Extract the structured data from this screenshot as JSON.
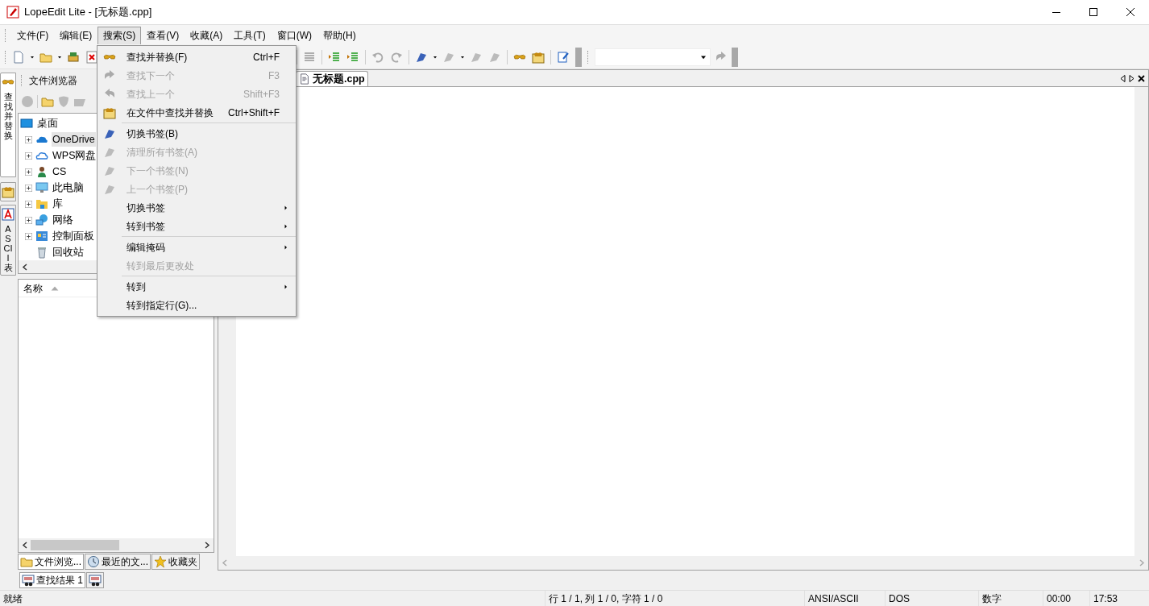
{
  "window": {
    "title": "LopeEdit Lite - [无标题.cpp]"
  },
  "menubar": [
    {
      "label": "文件(F)",
      "selected": false
    },
    {
      "label": "编辑(E)",
      "selected": false
    },
    {
      "label": "搜索(S)",
      "selected": true
    },
    {
      "label": "查看(V)",
      "selected": false
    },
    {
      "label": "收藏(A)",
      "selected": false
    },
    {
      "label": "工具(T)",
      "selected": false
    },
    {
      "label": "窗口(W)",
      "selected": false
    },
    {
      "label": "帮助(H)",
      "selected": false
    }
  ],
  "side_tabs": [
    {
      "kind": "text",
      "label": "查找并替换",
      "selected": true
    },
    {
      "kind": "icon",
      "selected": false
    },
    {
      "kind": "text",
      "label": "ASCII 表",
      "selected": false
    }
  ],
  "file_browser": {
    "title": "文件浏览器",
    "tree": [
      {
        "label": "桌面",
        "selected": false,
        "children": [
          {
            "label": "OneDrive",
            "expanded": false,
            "selected": true
          },
          {
            "label": "WPS网盘",
            "expanded": false,
            "selected": false
          },
          {
            "label": "CS",
            "expanded": false,
            "selected": false
          },
          {
            "label": "此电脑",
            "expanded": false,
            "selected": false
          },
          {
            "label": "库",
            "expanded": false,
            "selected": false
          },
          {
            "label": "网络",
            "expanded": false,
            "selected": false
          },
          {
            "label": "控制面板",
            "expanded": false,
            "selected": false
          },
          {
            "label": "回收站",
            "selected": false
          }
        ]
      }
    ],
    "columns": [
      {
        "label": "名称",
        "sorted": true
      }
    ],
    "tabs": [
      {
        "label": "文件浏览...",
        "selected": true
      },
      {
        "label": "最近的文...",
        "selected": false
      },
      {
        "label": "收藏夹",
        "selected": false
      }
    ]
  },
  "editor": {
    "tabs": [
      {
        "label": "无标题.cpp",
        "selected": true
      }
    ]
  },
  "menu": [
    {
      "kind": "item",
      "label": "查找并替换(F)",
      "shortcut": "Ctrl+F",
      "disabled": false
    },
    {
      "kind": "item",
      "label": "查找下一个",
      "shortcut": "F3",
      "disabled": true
    },
    {
      "kind": "item",
      "label": "查找上一个",
      "shortcut": "Shift+F3",
      "disabled": true
    },
    {
      "kind": "item",
      "label": "在文件中查找并替换",
      "shortcut": "Ctrl+Shift+F",
      "disabled": false
    },
    {
      "kind": "separator"
    },
    {
      "kind": "item",
      "label": "切换书签(B)",
      "disabled": false
    },
    {
      "kind": "item",
      "label": "清理所有书签(A)",
      "disabled": true
    },
    {
      "kind": "item",
      "label": "下一个书签(N)",
      "disabled": true
    },
    {
      "kind": "item",
      "label": "上一个书签(P)",
      "disabled": true
    },
    {
      "kind": "item",
      "label": "切换书签",
      "disabled": false,
      "submenu": true
    },
    {
      "kind": "item",
      "label": "转到书签",
      "disabled": false,
      "submenu": true
    },
    {
      "kind": "separator"
    },
    {
      "kind": "item",
      "label": "编辑掩码",
      "disabled": false,
      "submenu": true
    },
    {
      "kind": "item",
      "label": "转到最后更改处",
      "disabled": true
    },
    {
      "kind": "separator"
    },
    {
      "kind": "item",
      "label": "转到",
      "disabled": false,
      "submenu": true
    },
    {
      "kind": "item",
      "label": "转到指定行(G)...",
      "disabled": false
    }
  ],
  "bottom_tabs": [
    {
      "kind": "text",
      "label": "查找结果 1",
      "selected": true
    },
    {
      "kind": "icon",
      "selected": false
    }
  ],
  "status_bar": [
    "就绪",
    "行 1 / 1, 列 1 / 0, 字符 1 / 0",
    "ANSI/ASCII",
    "DOS",
    "数字",
    "00:00",
    "17:53"
  ]
}
